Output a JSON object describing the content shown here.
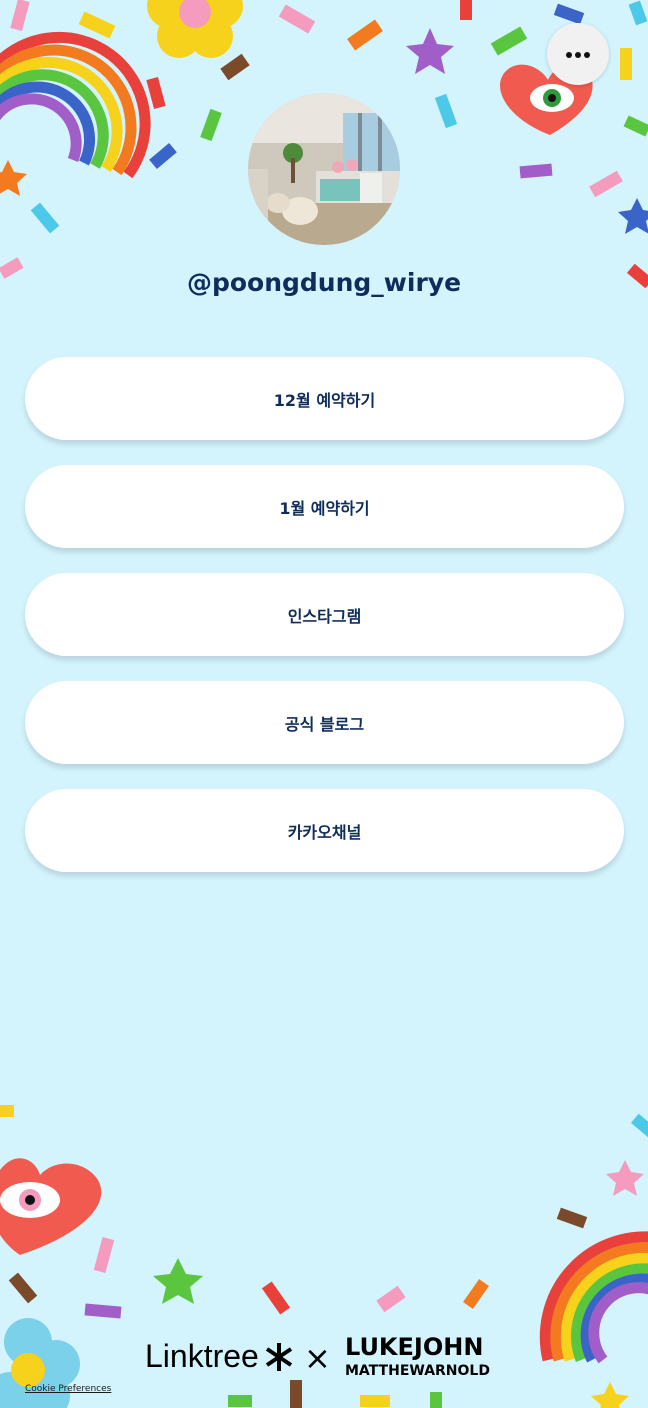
{
  "profile": {
    "username": "@poongdung_wirye",
    "avatar_alt": "Profile photo"
  },
  "menu": {
    "icon": "more-horizontal-icon"
  },
  "links": [
    {
      "label": "12월 예약하기"
    },
    {
      "label": "1월 예약하기"
    },
    {
      "label": "인스타그램"
    },
    {
      "label": "공식 블로그"
    },
    {
      "label": "카카오채널"
    }
  ],
  "footer": {
    "brand": "Linktree",
    "separator": "×",
    "collab_line1": "LUKEJOHN",
    "collab_line2": "MATTHEWARNOLD",
    "cookie_label": "Cookie Preferences"
  },
  "colors": {
    "background": "#d3f3fd",
    "button": "#ffffff",
    "text": "#0f2d5a"
  }
}
